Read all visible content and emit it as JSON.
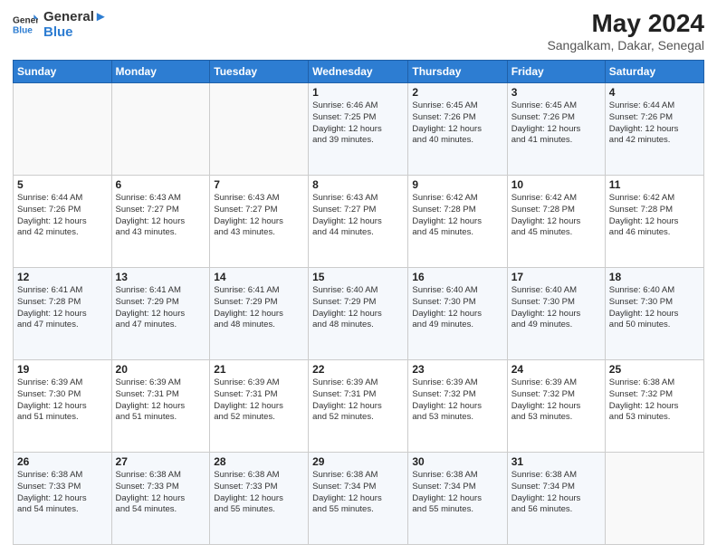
{
  "header": {
    "logo_line1": "General",
    "logo_line2": "Blue",
    "month_year": "May 2024",
    "location": "Sangalkam, Dakar, Senegal"
  },
  "weekdays": [
    "Sunday",
    "Monday",
    "Tuesday",
    "Wednesday",
    "Thursday",
    "Friday",
    "Saturday"
  ],
  "weeks": [
    [
      {
        "day": "",
        "info": ""
      },
      {
        "day": "",
        "info": ""
      },
      {
        "day": "",
        "info": ""
      },
      {
        "day": "1",
        "info": "Sunrise: 6:46 AM\nSunset: 7:25 PM\nDaylight: 12 hours\nand 39 minutes."
      },
      {
        "day": "2",
        "info": "Sunrise: 6:45 AM\nSunset: 7:26 PM\nDaylight: 12 hours\nand 40 minutes."
      },
      {
        "day": "3",
        "info": "Sunrise: 6:45 AM\nSunset: 7:26 PM\nDaylight: 12 hours\nand 41 minutes."
      },
      {
        "day": "4",
        "info": "Sunrise: 6:44 AM\nSunset: 7:26 PM\nDaylight: 12 hours\nand 42 minutes."
      }
    ],
    [
      {
        "day": "5",
        "info": "Sunrise: 6:44 AM\nSunset: 7:26 PM\nDaylight: 12 hours\nand 42 minutes."
      },
      {
        "day": "6",
        "info": "Sunrise: 6:43 AM\nSunset: 7:27 PM\nDaylight: 12 hours\nand 43 minutes."
      },
      {
        "day": "7",
        "info": "Sunrise: 6:43 AM\nSunset: 7:27 PM\nDaylight: 12 hours\nand 43 minutes."
      },
      {
        "day": "8",
        "info": "Sunrise: 6:43 AM\nSunset: 7:27 PM\nDaylight: 12 hours\nand 44 minutes."
      },
      {
        "day": "9",
        "info": "Sunrise: 6:42 AM\nSunset: 7:28 PM\nDaylight: 12 hours\nand 45 minutes."
      },
      {
        "day": "10",
        "info": "Sunrise: 6:42 AM\nSunset: 7:28 PM\nDaylight: 12 hours\nand 45 minutes."
      },
      {
        "day": "11",
        "info": "Sunrise: 6:42 AM\nSunset: 7:28 PM\nDaylight: 12 hours\nand 46 minutes."
      }
    ],
    [
      {
        "day": "12",
        "info": "Sunrise: 6:41 AM\nSunset: 7:28 PM\nDaylight: 12 hours\nand 47 minutes."
      },
      {
        "day": "13",
        "info": "Sunrise: 6:41 AM\nSunset: 7:29 PM\nDaylight: 12 hours\nand 47 minutes."
      },
      {
        "day": "14",
        "info": "Sunrise: 6:41 AM\nSunset: 7:29 PM\nDaylight: 12 hours\nand 48 minutes."
      },
      {
        "day": "15",
        "info": "Sunrise: 6:40 AM\nSunset: 7:29 PM\nDaylight: 12 hours\nand 48 minutes."
      },
      {
        "day": "16",
        "info": "Sunrise: 6:40 AM\nSunset: 7:30 PM\nDaylight: 12 hours\nand 49 minutes."
      },
      {
        "day": "17",
        "info": "Sunrise: 6:40 AM\nSunset: 7:30 PM\nDaylight: 12 hours\nand 49 minutes."
      },
      {
        "day": "18",
        "info": "Sunrise: 6:40 AM\nSunset: 7:30 PM\nDaylight: 12 hours\nand 50 minutes."
      }
    ],
    [
      {
        "day": "19",
        "info": "Sunrise: 6:39 AM\nSunset: 7:30 PM\nDaylight: 12 hours\nand 51 minutes."
      },
      {
        "day": "20",
        "info": "Sunrise: 6:39 AM\nSunset: 7:31 PM\nDaylight: 12 hours\nand 51 minutes."
      },
      {
        "day": "21",
        "info": "Sunrise: 6:39 AM\nSunset: 7:31 PM\nDaylight: 12 hours\nand 52 minutes."
      },
      {
        "day": "22",
        "info": "Sunrise: 6:39 AM\nSunset: 7:31 PM\nDaylight: 12 hours\nand 52 minutes."
      },
      {
        "day": "23",
        "info": "Sunrise: 6:39 AM\nSunset: 7:32 PM\nDaylight: 12 hours\nand 53 minutes."
      },
      {
        "day": "24",
        "info": "Sunrise: 6:39 AM\nSunset: 7:32 PM\nDaylight: 12 hours\nand 53 minutes."
      },
      {
        "day": "25",
        "info": "Sunrise: 6:38 AM\nSunset: 7:32 PM\nDaylight: 12 hours\nand 53 minutes."
      }
    ],
    [
      {
        "day": "26",
        "info": "Sunrise: 6:38 AM\nSunset: 7:33 PM\nDaylight: 12 hours\nand 54 minutes."
      },
      {
        "day": "27",
        "info": "Sunrise: 6:38 AM\nSunset: 7:33 PM\nDaylight: 12 hours\nand 54 minutes."
      },
      {
        "day": "28",
        "info": "Sunrise: 6:38 AM\nSunset: 7:33 PM\nDaylight: 12 hours\nand 55 minutes."
      },
      {
        "day": "29",
        "info": "Sunrise: 6:38 AM\nSunset: 7:34 PM\nDaylight: 12 hours\nand 55 minutes."
      },
      {
        "day": "30",
        "info": "Sunrise: 6:38 AM\nSunset: 7:34 PM\nDaylight: 12 hours\nand 55 minutes."
      },
      {
        "day": "31",
        "info": "Sunrise: 6:38 AM\nSunset: 7:34 PM\nDaylight: 12 hours\nand 56 minutes."
      },
      {
        "day": "",
        "info": ""
      }
    ]
  ]
}
